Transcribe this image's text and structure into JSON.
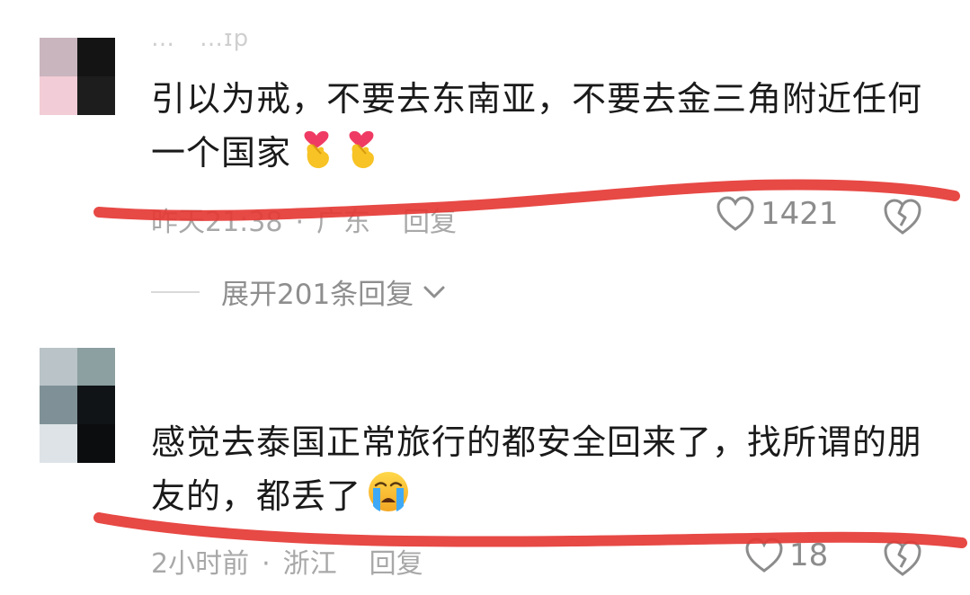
{
  "comments": [
    {
      "username": "…　…ɪp",
      "text": "引以为戒，不要去东南亚，不要去金三角附近任何一个国家",
      "emoji": [
        "finger-heart-emoji",
        "finger-heart-emoji"
      ],
      "time": "昨天21:38",
      "location": "广东",
      "reply_label": "回复",
      "likes": "1421",
      "expand_replies": "展开201条回复"
    },
    {
      "text": "感觉去泰国正常旅行的都安全回来了，找所谓的朋友的，都丢了",
      "emoji": [
        "crying-face-emoji"
      ],
      "time": "2小时前",
      "location": "浙江",
      "reply_label": "回复",
      "likes": "18"
    }
  ],
  "separator": "·",
  "colors": {
    "text": "#1a1a1a",
    "meta": "#a8a8a8",
    "annotation_red": "#e53935"
  }
}
